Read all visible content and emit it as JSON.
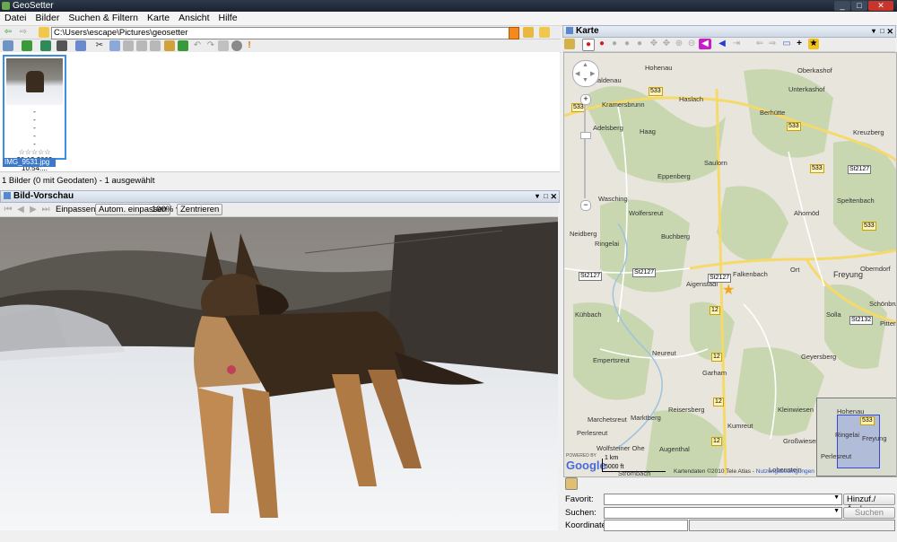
{
  "window": {
    "title": "GeoSetter"
  },
  "menu": [
    "Datei",
    "Bilder",
    "Suchen & Filtern",
    "Karte",
    "Ansicht",
    "Hilfe"
  ],
  "path": {
    "value": "C:\\Users\\escape\\Pictures\\geosetter"
  },
  "thumbnail": {
    "lines": [
      "-",
      "-",
      "-",
      "-",
      "-"
    ],
    "rating": "☆☆☆☆☆",
    "date": "20.12.2009 10:54:...",
    "filename": "IMG_9531.jpg"
  },
  "status": "1 Bilder (0 mit Geodaten) - 1 ausgewählt",
  "preview": {
    "title": "Bild-Vorschau",
    "fit_label": "Einpassen",
    "auto_fit_button": "Autom. einpassen",
    "zoom": "100%",
    "center_button": "Zentrieren"
  },
  "map": {
    "title": "Karte",
    "places": [
      {
        "name": "Hohenau"
      },
      {
        "name": "Oberkashof"
      },
      {
        "name": "Saldenau"
      },
      {
        "name": "Unterkashof"
      },
      {
        "name": "Haslach"
      },
      {
        "name": "Kramersbrunn"
      },
      {
        "name": "Berhütte"
      },
      {
        "name": "Adelsberg"
      },
      {
        "name": "Haag"
      },
      {
        "name": "Kreuzberg"
      },
      {
        "name": "Saulorn"
      },
      {
        "name": "Eppenberg"
      },
      {
        "name": "Speltenbach"
      },
      {
        "name": "Wasching"
      },
      {
        "name": "Wolfersreut"
      },
      {
        "name": "Ahornöd"
      },
      {
        "name": "Neidberg"
      },
      {
        "name": "Ringelai"
      },
      {
        "name": "Buchberg"
      },
      {
        "name": "Falkenbach"
      },
      {
        "name": "Aigenstadl"
      },
      {
        "name": "Ort"
      },
      {
        "name": "Freyung"
      },
      {
        "name": "Oberndorf"
      },
      {
        "name": "Kühbach"
      },
      {
        "name": "Schönbrunn"
      },
      {
        "name": "Solla"
      },
      {
        "name": "Pitters"
      },
      {
        "name": "Neureut"
      },
      {
        "name": "Empertsreut"
      },
      {
        "name": "Geyersberg"
      },
      {
        "name": "Garham"
      },
      {
        "name": "Reisersberg"
      },
      {
        "name": "Kleinwiesen"
      },
      {
        "name": "Marchetsreut"
      },
      {
        "name": "Marktberg"
      },
      {
        "name": "Kumreut"
      },
      {
        "name": "Großwiesen"
      },
      {
        "name": "Augenthal"
      },
      {
        "name": "Wolfsteiner Ohe"
      },
      {
        "name": "Lobenstein"
      },
      {
        "name": "Perlesreut"
      }
    ],
    "roads": [
      "533",
      "533",
      "533",
      "533",
      "533",
      "St2127",
      "St2127",
      "St2127",
      "St2127",
      "St2132",
      "12",
      "12",
      "12",
      "12"
    ],
    "scale": {
      "km": "1 km",
      "ft": "5000 ft"
    },
    "copyright": "Kartendaten ©2010 Tele Atlas - ",
    "terms_link": "Nutzungsbedingungen",
    "google": "Google",
    "powered": "POWERED BY",
    "minimap": {
      "road": "533",
      "place1": "Hohenau",
      "place2": "Ringelai",
      "place3": "Freyung",
      "place4": "Perlesreut"
    },
    "extra_place": "Strombach"
  },
  "form": {
    "favorite_label": "Favorit:",
    "add_change_button": "Hinzuf./Ändern...",
    "search_label": "Suchen:",
    "search_button": "Suchen",
    "coords_label": "Koordinaten:"
  },
  "colors": {
    "selection": "#3b78c8",
    "map_marker": "#f2a516",
    "nav_magenta": "#c81ec8",
    "nav_blue": "#1e3fd6"
  }
}
